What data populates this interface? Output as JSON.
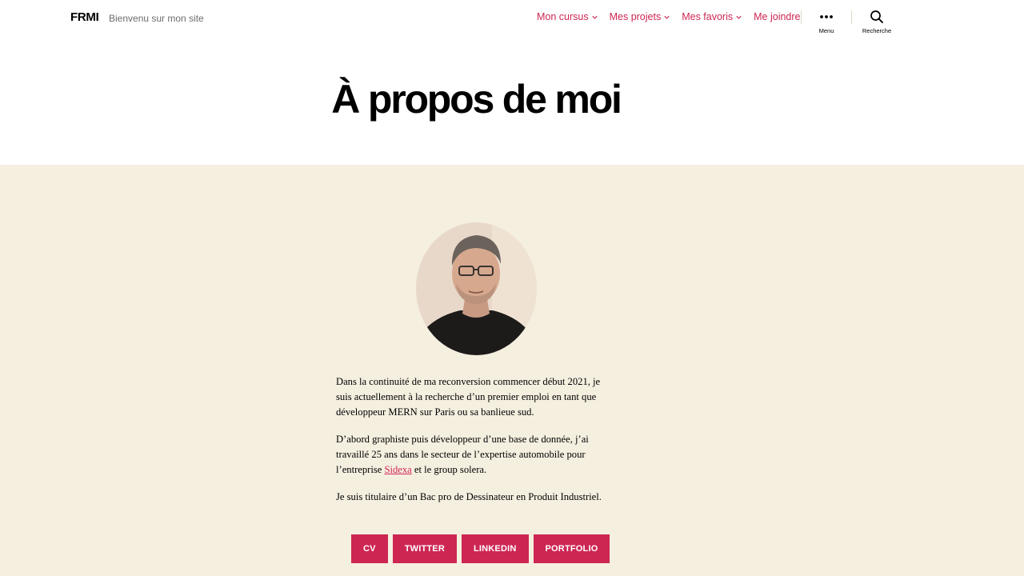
{
  "header": {
    "site_title": "FRMI",
    "site_description": "Bienvenu sur mon site",
    "nav": [
      {
        "label": "Mon cursus",
        "has_dropdown": true
      },
      {
        "label": "Mes projets",
        "has_dropdown": true
      },
      {
        "label": "Mes favoris",
        "has_dropdown": true
      },
      {
        "label": "Me joindre",
        "has_dropdown": false
      }
    ],
    "menu_label": "Menu",
    "search_label": "Recherche"
  },
  "page": {
    "title": "À propos de moi"
  },
  "content": {
    "paragraph1": "Dans la continuité de ma reconversion commencer début 2021, je suis actuellement à la recherche d’un premier emploi en tant que développeur MERN sur Paris ou sa banlieue sud.",
    "paragraph2_before": "D’abord graphiste puis développeur d’une base de donnée, j’ai travaillé 25 ans dans le secteur de l’expertise automobile pour l’entreprise ",
    "paragraph2_link": "Sidexa",
    "paragraph2_after": " et le group solera.",
    "paragraph3": "Je suis titulaire d’un Bac pro de Dessinateur en Produit Industriel.",
    "buttons": [
      "CV",
      "TWITTER",
      "LINKEDIN",
      "PORTFOLIO"
    ]
  },
  "colors": {
    "accent": "#cd2653",
    "content_background": "#f5efe0",
    "header_background": "#ffffff"
  }
}
